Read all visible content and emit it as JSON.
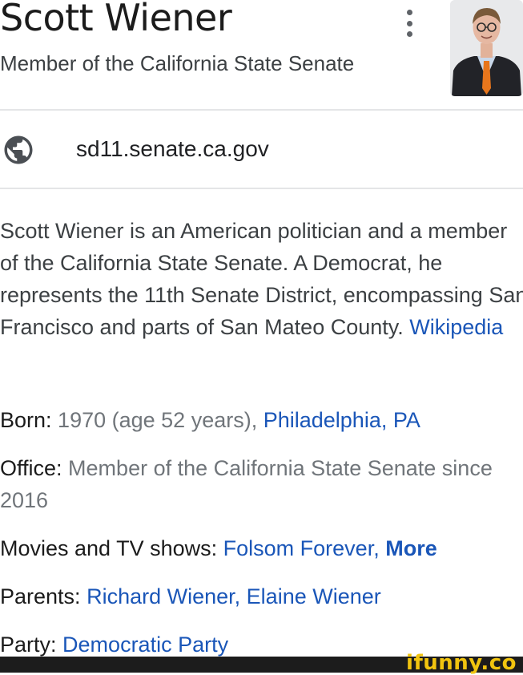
{
  "knowledge_panel": {
    "title": "Scott Wiener",
    "subtitle": "Member of the California State Senate",
    "website": "sd11.senate.ca.gov",
    "description": {
      "text": "Scott Wiener is an American politician and a member of the California State Senate. A Democrat, he represents the 11th Senate District, encompassing San Francisco and parts of San Mateo County. ",
      "source": "Wikipedia"
    },
    "facts": {
      "born": {
        "label": "Born:",
        "value": " 1970 (age 52 years), ",
        "place": "Philadelphia, PA"
      },
      "office": {
        "label": "Office:",
        "value": " Member of the California State Senate since 2016"
      },
      "movies": {
        "label": "Movies and TV shows:",
        "item": "Folsom Forever",
        "separator": ", ",
        "more": "More"
      },
      "parents": {
        "label": "Parents:",
        "parent1": "Richard Wiener",
        "separator": ", ",
        "parent2": "Elaine Wiener"
      },
      "party": {
        "label": "Party:",
        "value": "Democratic Party"
      }
    }
  },
  "watermark": "ifunny.co",
  "icons": {
    "menu": "more-vert-icon",
    "website": "globe-icon"
  },
  "colors": {
    "link": "#1a56b8",
    "muted_text": "#70757a",
    "watermark": "#f1c40f"
  }
}
